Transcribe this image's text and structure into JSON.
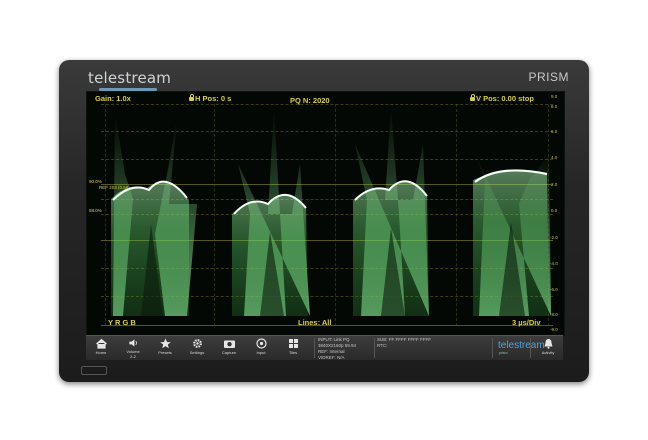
{
  "device": {
    "brand": "telestream",
    "model": "PRISM"
  },
  "overlay": {
    "gain": "Gain: 1.0x",
    "hpos": "H Pos: 0 s",
    "pq": "PQ N: 2020",
    "vpos": "V Pos: 0.00 stop",
    "channels": "Y R G B",
    "lines": "Lines: All",
    "timebase": "3 µs/Div"
  },
  "left_markers": [
    "90.0%",
    "REF 203 (0.58)",
    "58.0%"
  ],
  "right_scale": [
    "9.0",
    "8.0",
    "6.0",
    "4.0",
    "2.0",
    "0.0",
    "-2.0",
    "-4.0",
    "-6.0",
    "-8.0",
    "-9.0"
  ],
  "toolbar": {
    "buttons": [
      {
        "label": "Home",
        "icon": "home-icon"
      },
      {
        "label": "Volume",
        "sub": "2-2",
        "icon": "volume-icon"
      },
      {
        "label": "Presets",
        "icon": "star-icon"
      },
      {
        "label": "Settings",
        "icon": "gear-icon"
      },
      {
        "label": "Capture",
        "icon": "camera-icon"
      },
      {
        "label": "Input",
        "icon": "input-icon"
      },
      {
        "label": "Tiles",
        "icon": "tiles-icon"
      }
    ],
    "input_lines": [
      "INPUT: Link PQ",
      "3840X2160p 59.94",
      "REF: Internal",
      "VIDREF: N/A"
    ],
    "sub_lines": [
      "SUB:  FF FFFF FFFF FFFF",
      "RTC:"
    ],
    "logo": "telestream",
    "logo_sub": "prism",
    "activity": "Activity"
  },
  "colors": {
    "trace": "#7fe08a",
    "overlay_text": "#d8cf41",
    "bezel": "#262626"
  }
}
